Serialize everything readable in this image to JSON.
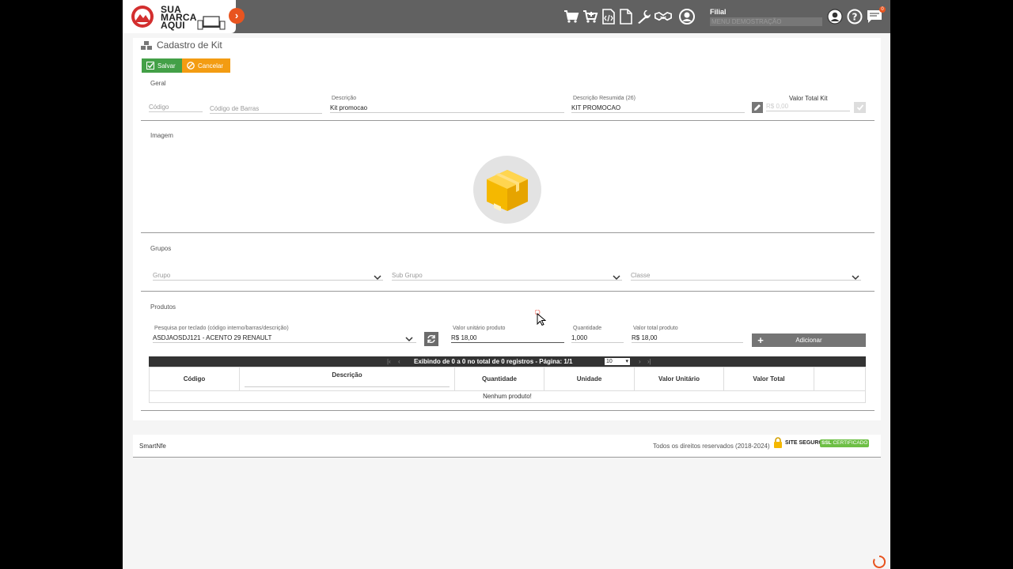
{
  "header": {
    "logo_lines": [
      "SUA",
      "MARCA",
      "AQUI"
    ],
    "filial_label": "Filial",
    "filial_value": "MENU DEMOSTRAÇÃO",
    "notification_count": "0",
    "icons": [
      "cart-icon",
      "add-to-cart-icon",
      "xml-document-icon",
      "document-icon",
      "wrench-icon",
      "handshake-icon",
      "user-circle-icon",
      "account-icon",
      "help-icon",
      "chat-icon"
    ]
  },
  "page": {
    "title": "Cadastro de Kit",
    "save_label": "Salvar",
    "cancel_label": "Cancelar"
  },
  "geral": {
    "section": "Geral",
    "codigo_placeholder": "Código",
    "codigo_barras_placeholder": "Código de Barras",
    "descricao_label": "Descrição",
    "descricao_value": "Kit promocao",
    "descricao_resumida_label": "Descrição Resumida (26)",
    "descricao_resumida_value": "KIT PROMOCAO",
    "valor_total_label": "Valor Total Kit",
    "valor_total_value": "R$ 0,00"
  },
  "imagem": {
    "section": "Imagem"
  },
  "grupos": {
    "section": "Grupos",
    "grupo_placeholder": "Grupo",
    "subgrupo_placeholder": "Sub Grupo",
    "classe_placeholder": "Classe"
  },
  "produtos": {
    "section": "Produtos",
    "search_label": "Pesquisa por teclado (código interno/barras/descrição)",
    "search_value": "ASDJAOSDJ121 - ACENTO 29 RENAULT",
    "valor_unitario_label": "Valor unitário produto",
    "valor_unitario_value": "R$ 18,00",
    "quantidade_label": "Quantidade",
    "quantidade_value": "1,000",
    "valor_total_label": "Valor total produto",
    "valor_total_value": "R$ 18,00",
    "add_label": "Adicionar"
  },
  "table": {
    "pager_text": "Exibindo de 0 a 0 no total de 0 registros - Página: 1/1",
    "page_size": "10",
    "columns": [
      "Código",
      "Descrição",
      "Quantidade",
      "Unidade",
      "Valor Unitário",
      "Valor Total"
    ],
    "empty_text": "Nenhum produto!"
  },
  "footer": {
    "brand": "SmartNfe",
    "rights": "Todos os direitos reservados (2018-2024)",
    "site_seguro": "SITE SEGURO",
    "ssl_strong": "SSL",
    "ssl_rest": "CERTIFICADO"
  },
  "colors": {
    "header_bg": "#616161",
    "save_green": "#43a047",
    "cancel_orange": "#f39c12",
    "accent_orange": "#e8541f"
  }
}
